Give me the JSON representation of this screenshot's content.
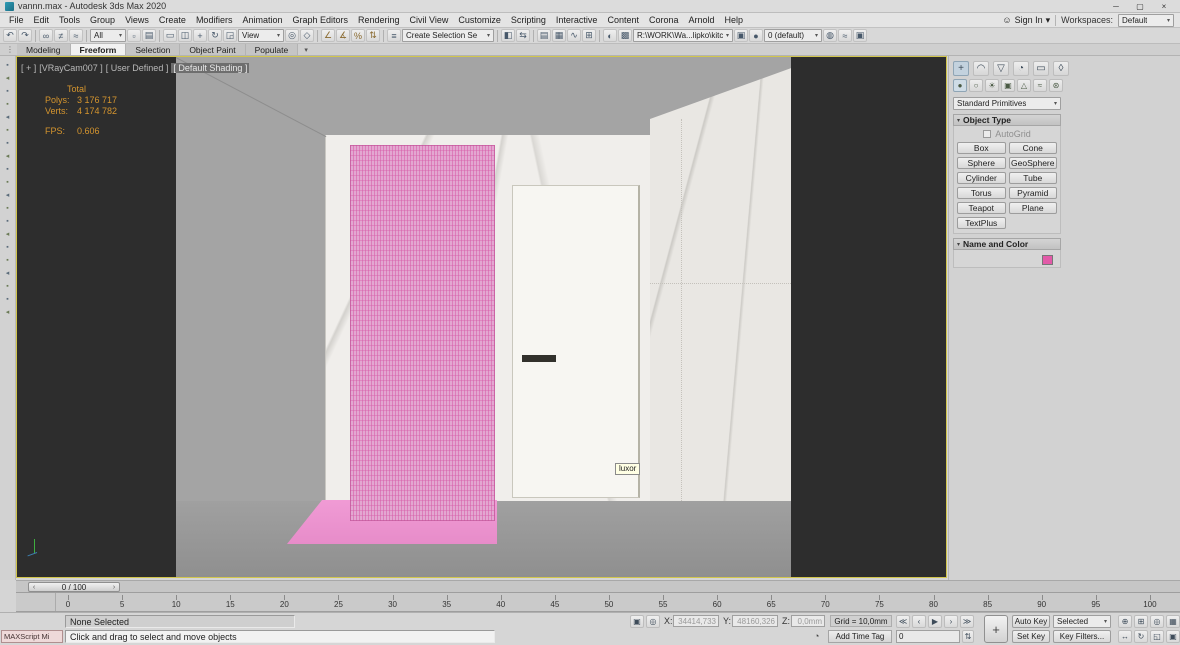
{
  "window": {
    "title": "vannn.max - Autodesk 3ds Max 2020"
  },
  "menubar": {
    "items": [
      "File",
      "Edit",
      "Tools",
      "Group",
      "Views",
      "Create",
      "Modifiers",
      "Animation",
      "Graph Editors",
      "Rendering",
      "Civil View",
      "Customize",
      "Scripting",
      "Interactive",
      "Content",
      "Corona",
      "Arnold",
      "Help"
    ],
    "sign_in": "Sign In",
    "workspaces_label": "Workspaces:",
    "workspace": "Default"
  },
  "toolbar": {
    "selection_filter": "All",
    "ref_coord": "View",
    "named_sets_placeholder": "Create Selection Se",
    "scene_path": "R:\\WORK\\Wa...lipko\\kitch",
    "render_preset": "0 (default)"
  },
  "ribbon": {
    "tabs": [
      "Modeling",
      "Freeform",
      "Selection",
      "Object Paint",
      "Populate"
    ],
    "active": "Freeform"
  },
  "viewport": {
    "label_pos": "[ + ]",
    "label_cam": "[VRayCam007 ]",
    "label_user": "[ User Defined ]",
    "label_shading": "[ Default Shading ]",
    "stats": {
      "total": "Total",
      "polys_label": "Polys:",
      "polys": "3 176 717",
      "verts_label": "Verts:",
      "verts": "4 174 782",
      "fps_label": "FPS:",
      "fps": "0.606"
    },
    "tooltip": "luxor"
  },
  "command_panel": {
    "category_dropdown": "Standard Primitives",
    "object_type": "Object Type",
    "autogrid": "AutoGrid",
    "buttons": [
      "Box",
      "Cone",
      "Sphere",
      "GeoSphere",
      "Cylinder",
      "Tube",
      "Torus",
      "Pyramid",
      "Teapot",
      "Plane",
      "TextPlus"
    ],
    "name_color": "Name and Color",
    "swatch_color": "#e25aa8"
  },
  "timeline": {
    "slider": "0 / 100",
    "ticks": [
      "0",
      "5",
      "10",
      "15",
      "20",
      "25",
      "30",
      "35",
      "40",
      "45",
      "50",
      "55",
      "60",
      "65",
      "70",
      "75",
      "80",
      "85",
      "90",
      "95",
      "100"
    ]
  },
  "status": {
    "selection": "None Selected",
    "maxscript": "MAXScript Mi",
    "prompt": "Click and drag to select and move objects",
    "x": "X:",
    "xv": "34414,733",
    "y": "Y:",
    "yv": "48160,326",
    "z": "Z:",
    "zv": "0,0mm",
    "grid": "Grid = 10,0mm",
    "add_time_tag": "Add Time Tag",
    "frame": "0",
    "auto_key": "Auto Key",
    "selected": "Selected",
    "set_key": "Set Key",
    "key_filters": "Key Filters..."
  },
  "icons": {
    "user": "☺",
    "ddarrow": "▾",
    "min": "─",
    "restore": "▢",
    "close": "×",
    "undo": "↶",
    "redo": "↷",
    "link": "∞",
    "unlink": "≠",
    "bind": "≈",
    "select": "▫",
    "byname": "▤",
    "region": "▭",
    "crossing": "◫",
    "move": "+",
    "rotate": "↻",
    "scale": "◲",
    "pivot": "◎",
    "manipulate": "◇",
    "snap": "∠",
    "asnap": "∡",
    "psnap": "%",
    "ssnap": "⇅",
    "editsets": "≡",
    "mirror": "◧",
    "align": "⇆",
    "layers": "▤",
    "ribbon": "▦",
    "curve": "∿",
    "schem": "⊞",
    "mat": "◐",
    "rsetup": "▩",
    "rframe": "▣",
    "render": "●",
    "render2": "◍",
    "cloud": "≈",
    "grip": "⋮",
    "chevdn": "▾",
    "dot": "▪",
    "tri": "◂",
    "create": "+",
    "modify": "◠",
    "hier": "▽",
    "motion": "◔",
    "disp": "▭",
    "utils": "◊",
    "geom": "●",
    "shapes": "○",
    "lights": "☀",
    "cams": "▣",
    "helpers": "△",
    "warps": "≈",
    "systems": "⊛",
    "rollarr": "▾",
    "gostart": "≪",
    "prev": "‹",
    "play": "▶",
    "next": "›",
    "goend": "≫",
    "keybig": "+",
    "lock": "▣",
    "absrel": "◎",
    "clock": "◔",
    "spin": "⇅",
    "zoom": "⊕",
    "zoomall": "⊞",
    "ext": "◎",
    "extall": "▦",
    "pan": "↔",
    "orbit": "↻",
    "zreg": "◱",
    "maxvp": "▣",
    "sliderl": "‹",
    "sliderr": "›"
  }
}
